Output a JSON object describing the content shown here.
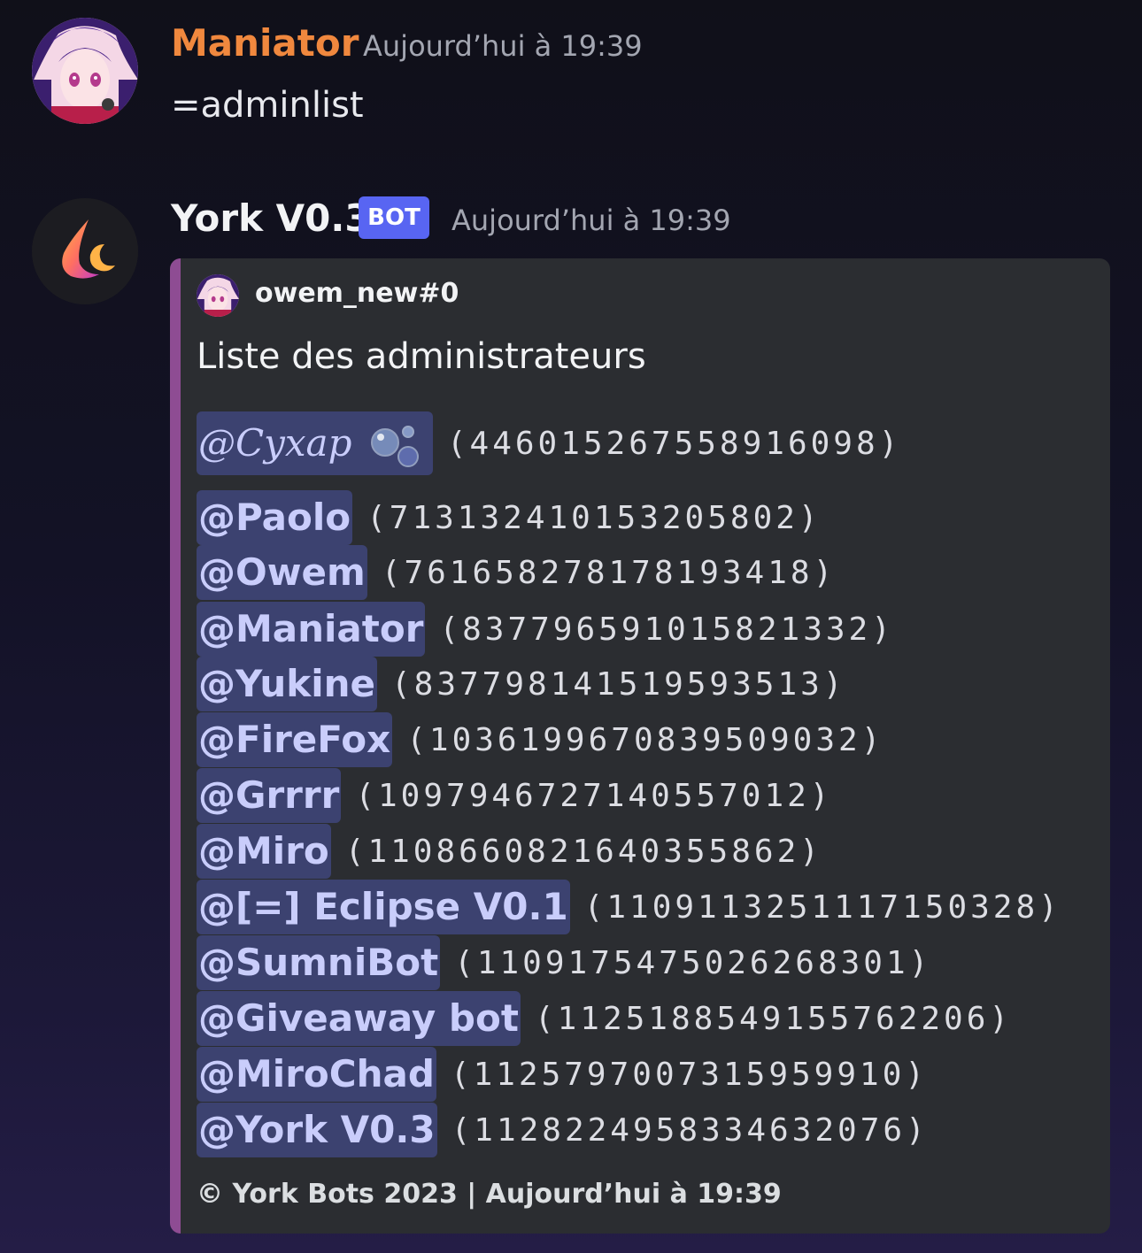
{
  "theme": {
    "background": "#131226",
    "embed_background": "#2b2d31",
    "embed_accent": "#8e4c93",
    "mention_background": "#3c4270",
    "mention_text": "#c9cdfb",
    "bot_tag_color": "#5865f2",
    "username_orange": "#f0883e"
  },
  "messages": [
    {
      "author": "Maniator",
      "author_color": "#f0883e",
      "timestamp": "Aujourd’hui à 19:39",
      "avatar_icon": "anime-girl-avatar-icon",
      "content": "=adminlist"
    },
    {
      "author": "York V0.3",
      "author_color": "#f2f3f5",
      "bot_tag": "BOT",
      "timestamp": "Aujourd’hui à 19:39",
      "avatar_icon": "flame-moon-logo-icon",
      "embed": {
        "author_name": "owem_new#0",
        "author_avatar_icon": "anime-girl-avatar-icon",
        "title": "Liste des administrateurs",
        "admins": [
          {
            "mention": "@Cyxap",
            "id": "(446015267558916098)",
            "emoji": "bubbles-emoji-icon"
          },
          {
            "mention": "@Paolo",
            "id": "(713132410153205802)"
          },
          {
            "mention": "@Owem",
            "id": "(761658278178193418)"
          },
          {
            "mention": "@Maniator",
            "id": "(837796591015821332)"
          },
          {
            "mention": "@Yukine",
            "id": "(837798141519593513)"
          },
          {
            "mention": "@FireFox",
            "id": "(1036199670839509032)"
          },
          {
            "mention": "@Grrrr",
            "id": "(1097946727140557012)"
          },
          {
            "mention": "@Miro",
            "id": "(1108660821640355862)"
          },
          {
            "mention": "@[=] Eclipse V0.1",
            "id": "(1109113251117150328)"
          },
          {
            "mention": "@SumniBot",
            "id": "(1109175475026268301)"
          },
          {
            "mention": "@Giveaway bot",
            "id": "(1125188549155762206)"
          },
          {
            "mention": "@MiroChad",
            "id": "(1125797007315959910)"
          },
          {
            "mention": "@York V0.3",
            "id": "(1128224958334632076)"
          }
        ],
        "footer": "© York Bots 2023 | Aujourd’hui à 19:39"
      }
    }
  ]
}
